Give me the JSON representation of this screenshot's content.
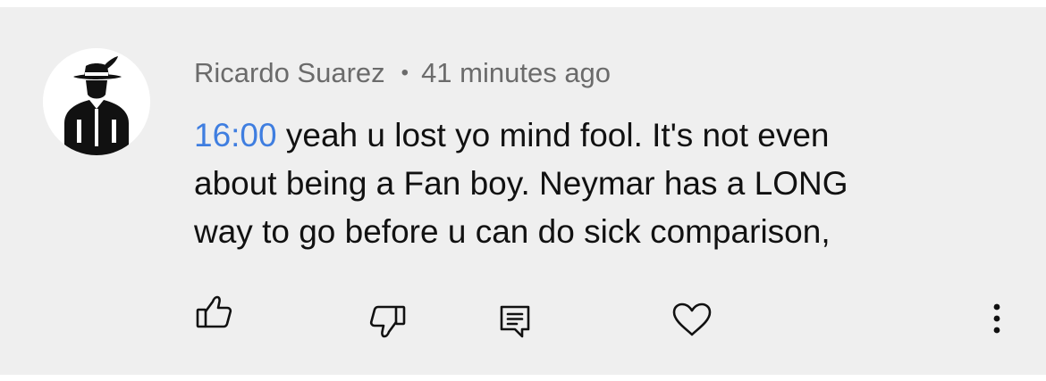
{
  "comment": {
    "author": "Ricardo Suarez",
    "separator": "•",
    "time_ago": "41 minutes ago",
    "timestamp_link": "16:00",
    "lines": [
      " yeah u lost yo mind fool. It's not even",
      "about being a Fan boy. Neymar has a LONG",
      "way to go before u can do sick comparison,"
    ]
  },
  "actions": [
    {
      "name": "like",
      "icon": "thumbs-up-icon"
    },
    {
      "name": "dislike",
      "icon": "thumbs-down-icon"
    },
    {
      "name": "reply",
      "icon": "comment-icon"
    },
    {
      "name": "heart",
      "icon": "heart-icon"
    },
    {
      "name": "more",
      "icon": "more-vertical-icon"
    }
  ],
  "colors": {
    "background": "#efefef",
    "text": "#111111",
    "meta": "#6b6b6b",
    "link": "#3f7ee0"
  }
}
